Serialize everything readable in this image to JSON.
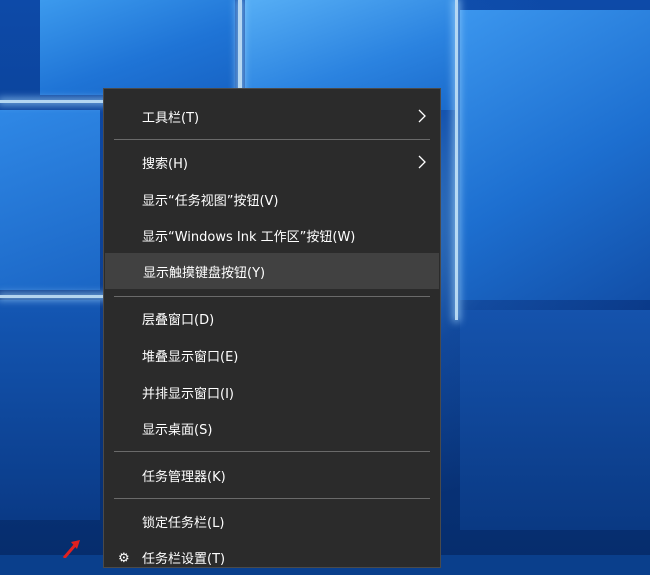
{
  "context_menu": {
    "items": [
      {
        "label": "工具栏(T)"
      },
      {
        "label": "搜索(H)"
      },
      {
        "label": "显示“任务视图”按钮(V)"
      },
      {
        "label": "显示“Windows Ink 工作区”按钮(W)"
      },
      {
        "label": "显示触摸键盘按钮(Y)"
      },
      {
        "label": "层叠窗口(D)"
      },
      {
        "label": "堆叠显示窗口(E)"
      },
      {
        "label": "并排显示窗口(I)"
      },
      {
        "label": "显示桌面(S)"
      },
      {
        "label": "任务管理器(K)"
      },
      {
        "label": "锁定任务栏(L)"
      },
      {
        "label": "任务栏设置(T)"
      }
    ]
  },
  "colors": {
    "menu_background": "#2b2b2b",
    "hover_background": "#414141",
    "separator": "#6a6a6a",
    "text": "#ffffff"
  },
  "icons": {
    "submenu": "chevron-right-icon",
    "settings": "gear-icon",
    "pointer": "red-arrow-icon"
  }
}
